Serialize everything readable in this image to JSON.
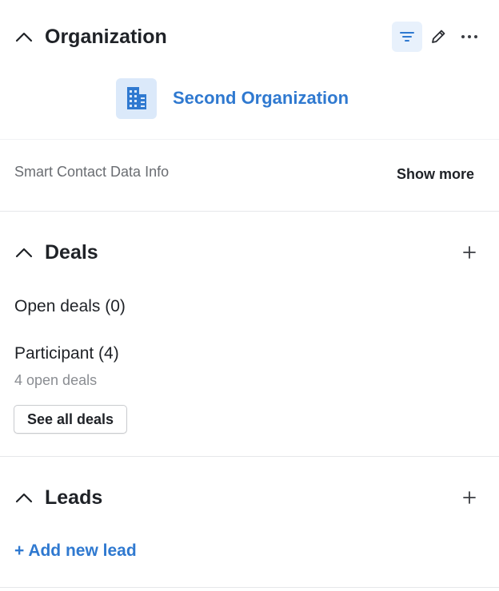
{
  "organization": {
    "title": "Organization",
    "name": "Second Organization",
    "icons": {
      "collapse": "chevron-up-icon",
      "filter": "filter-icon",
      "edit": "pencil-icon",
      "more": "more-horizontal-icon",
      "avatar": "building-icon"
    },
    "smart_contact_label": "Smart Contact Data Info",
    "show_more_label": "Show more"
  },
  "deals": {
    "title": "Deals",
    "open_deals_label": "Open deals (0)",
    "participant_label": "Participant (4)",
    "participant_sub": "4 open deals",
    "see_all_label": "See all deals",
    "icons": {
      "collapse": "chevron-up-icon",
      "add": "plus-icon"
    }
  },
  "leads": {
    "title": "Leads",
    "add_label": "+ Add new lead",
    "icons": {
      "collapse": "chevron-up-icon",
      "add": "plus-icon"
    }
  },
  "colors": {
    "accent": "#2f79d0",
    "accent_bg": "#dbe9fa",
    "text": "#1f2227",
    "muted": "#6a6d72",
    "divider": "#e6e7ea"
  }
}
